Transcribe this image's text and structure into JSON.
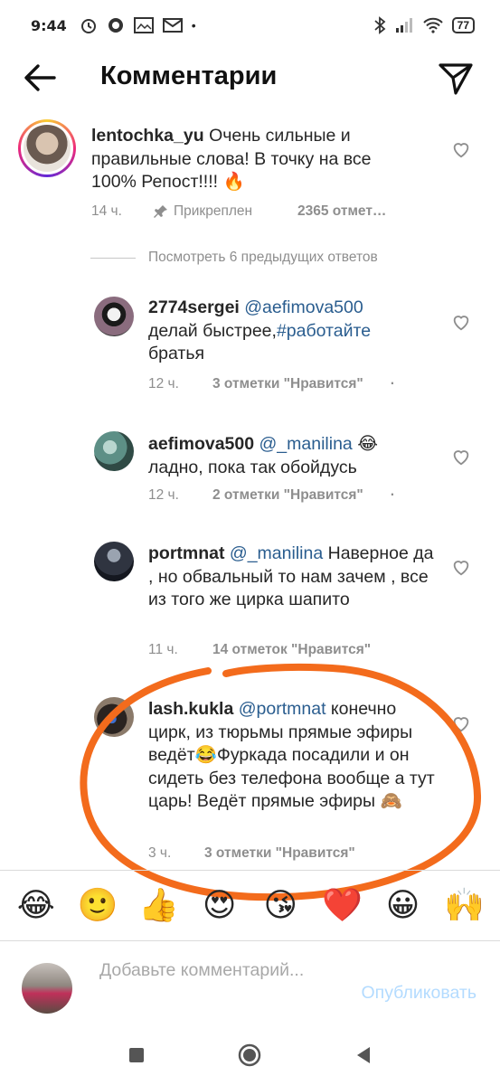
{
  "status_bar": {
    "time": "9:44",
    "battery": "77"
  },
  "header": {
    "title": "Комментарии"
  },
  "pinned_comment": {
    "username": "lentochka_yu",
    "text": "Очень сильные и правильные слова! В точку на все 100% Репост!!!! 🔥",
    "time": "14 ч.",
    "pinned_label": "Прикреплен",
    "likes": "2365 отмет…"
  },
  "view_previous": "Посмотреть 6 предыдущих ответов",
  "replies": [
    {
      "username": "2774sergei",
      "mention": "@aefimova500",
      "text_line1": "делай быстрее,",
      "hashtag": "#работайте",
      "text_line2": "братья",
      "time": "12 ч.",
      "likes": "3 отметки \"Нравится\""
    },
    {
      "username": "aefimova500",
      "mention": "@_manilina",
      "emoji": "😂",
      "text": "ладно, пока так обойдусь",
      "time": "12 ч.",
      "likes": "2 отметки \"Нравится\""
    },
    {
      "username": "portmnat",
      "mention": "@_manilina",
      "text_first": "Наверное",
      "text_rest": "да , но обвальный то нам зачем , все из  того же цирка шапито",
      "time": "11 ч.",
      "likes": "14 отметок \"Нравится\""
    },
    {
      "username": "lash.kukla",
      "mention": "@portmnat",
      "text_first": "конечно",
      "text_rest": "цирк, из тюрьмы прямые эфиры ведёт😂Фуркада посадили и он сидеть без телефона вообще а тут царь! Ведёт прямые эфиры 🙈",
      "time": "3 ч.",
      "likes": "3 отметки \"Нравится\""
    }
  ],
  "emoji_bar": [
    "😂",
    "🙂",
    "👍",
    "😍",
    "😘",
    "❤️",
    "😀",
    "🙌"
  ],
  "input": {
    "placeholder": "Добавьте комментарий...",
    "publish_label": "Опубликовать"
  },
  "colors": {
    "mention": "#2a5d8f",
    "annotation": "#f36b1c",
    "publish": "#b3dbff",
    "meta": "#8e8e8e"
  }
}
